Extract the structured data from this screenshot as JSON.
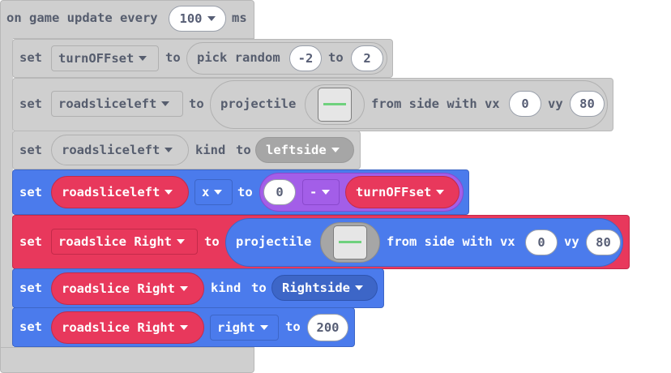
{
  "event": {
    "label": "on game update every",
    "interval": "100",
    "unit": "ms"
  },
  "blocks": {
    "b1": {
      "set": "set",
      "var": "turnOFFset",
      "to": "to",
      "fn": "pick random",
      "min": "-2",
      "mid": "to",
      "max": "2"
    },
    "b2": {
      "set": "set",
      "var": "roadsliceleft",
      "to": "to",
      "fn": "projectile",
      "from": "from side with vx",
      "vx": "0",
      "vy_label": "vy",
      "vy": "80"
    },
    "b3": {
      "set": "set",
      "var": "roadsliceleft",
      "kind_label": "kind",
      "to": "to",
      "kind": "leftside"
    },
    "b4": {
      "set": "set",
      "var": "roadsliceleft",
      "prop": "x",
      "to": "to",
      "left": "0",
      "op": "-",
      "right": "turnOFFset"
    },
    "b5": {
      "set": "set",
      "var": "roadslice Right",
      "to": "to",
      "fn": "projectile",
      "from": "from side with vx",
      "vx": "0",
      "vy_label": "vy",
      "vy": "80"
    },
    "b6": {
      "set": "set",
      "var": "roadslice Right",
      "kind_label": "kind",
      "to": "to",
      "kind": "Rightside"
    },
    "b7": {
      "set": "set",
      "var": "roadslice Right",
      "prop": "right",
      "to": "to",
      "value": "200"
    }
  },
  "colors": {
    "event": "#cfcfcf",
    "set_gray": "#cfcfcf",
    "set_blue": "#4b7bec",
    "set_red": "#e8385c",
    "var_red": "#e8385c",
    "math_purple": "#a35ee8",
    "kind_gray": "#a6a6a6",
    "kind_blue": "#3d66c7"
  }
}
